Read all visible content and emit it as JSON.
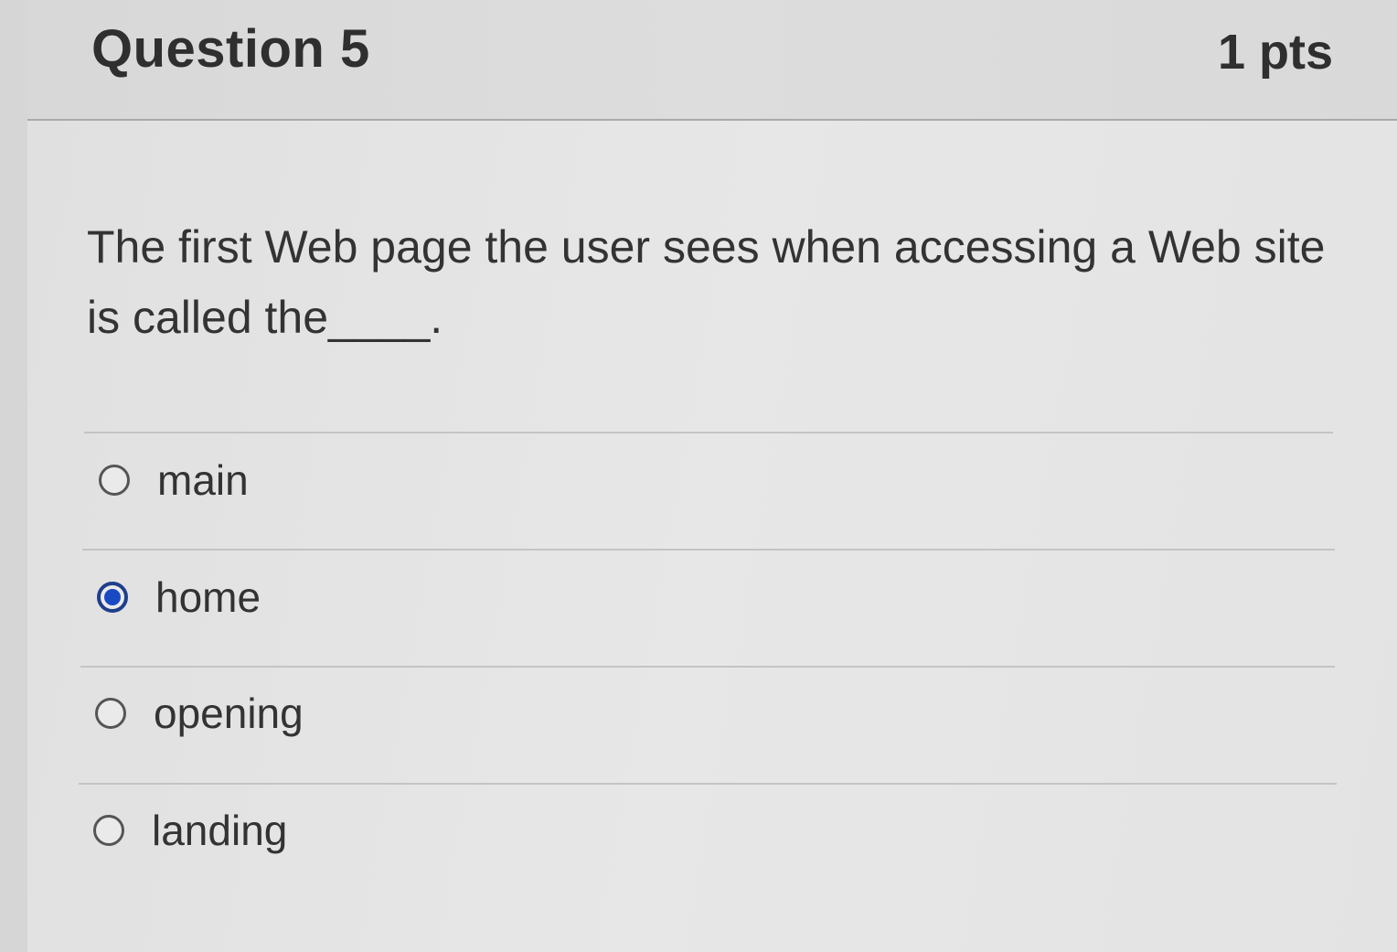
{
  "question": {
    "title": "Question 5",
    "points": "1 pts",
    "text": "The first Web page the user sees when accessing a Web site is called the____."
  },
  "answers": [
    {
      "label": "main",
      "selected": false
    },
    {
      "label": "home",
      "selected": true
    },
    {
      "label": "opening",
      "selected": false
    },
    {
      "label": "landing",
      "selected": false
    }
  ],
  "colors": {
    "selected_radio": "#1a49c4",
    "text": "#333333"
  }
}
